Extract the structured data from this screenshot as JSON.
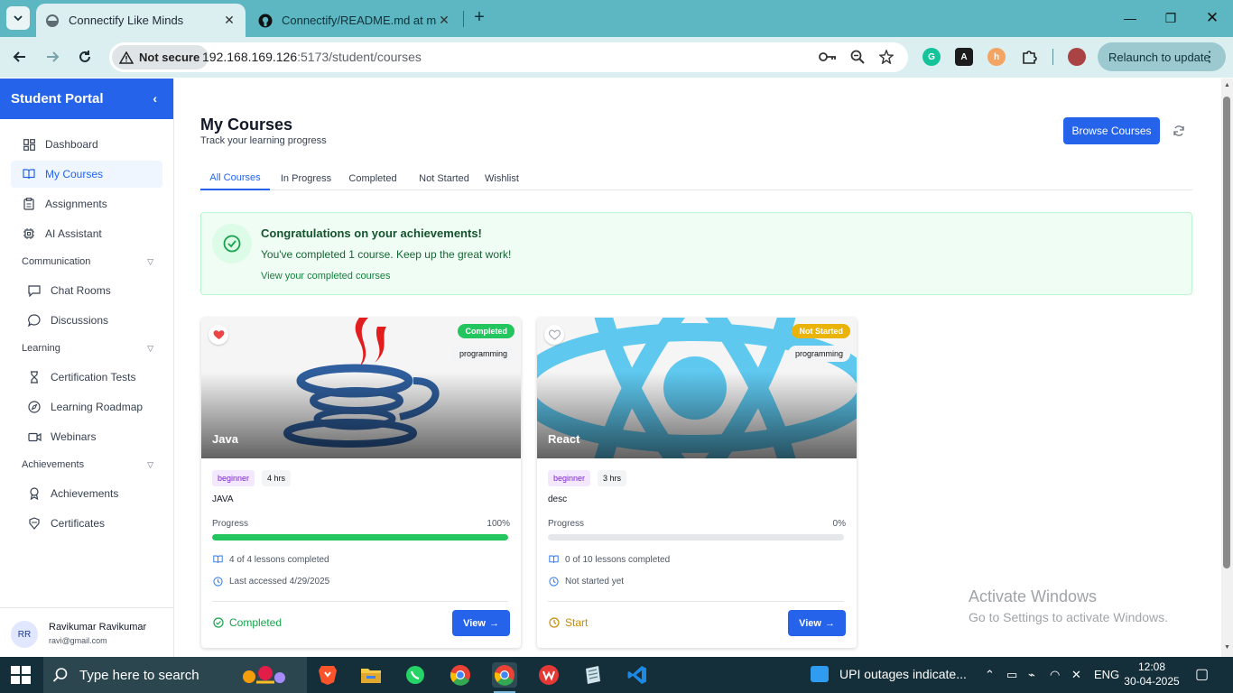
{
  "browser": {
    "tabs": [
      {
        "title": "Connectify Like Minds",
        "active": true
      },
      {
        "title": "Connectify/README.md at mai",
        "active": false
      }
    ],
    "security_label": "Not secure",
    "url_host": "192.168.169.126",
    "url_path": ":5173/student/courses",
    "relaunch_label": "Relaunch to update",
    "extensions": [
      "grammarly-icon",
      "adobe-acrobat-icon",
      "honey-icon",
      "puzzle-extensions-icon"
    ]
  },
  "sidebar": {
    "brand": "Student Portal",
    "items": [
      {
        "label": "Dashboard",
        "icon": "dashboard-grid-icon"
      },
      {
        "label": "My Courses",
        "icon": "book-open-icon",
        "active": true
      },
      {
        "label": "Assignments",
        "icon": "clipboard-icon"
      },
      {
        "label": "AI Assistant",
        "icon": "cpu-icon"
      }
    ],
    "groups": [
      {
        "label": "Communication",
        "items": [
          {
            "label": "Chat Rooms",
            "icon": "chat-square-icon"
          },
          {
            "label": "Discussions",
            "icon": "chat-bubble-icon"
          }
        ]
      },
      {
        "label": "Learning",
        "items": [
          {
            "label": "Certification Tests",
            "icon": "hourglass-icon"
          },
          {
            "label": "Learning Roadmap",
            "icon": "compass-icon"
          },
          {
            "label": "Webinars",
            "icon": "video-icon"
          }
        ]
      },
      {
        "label": "Achievements",
        "items": [
          {
            "label": "Achievements",
            "icon": "award-icon"
          },
          {
            "label": "Certificates",
            "icon": "badge-icon"
          }
        ]
      }
    ],
    "user": {
      "initials": "RR",
      "name": "Ravikumar Ravikumar",
      "email": "ravi@gmail.com"
    }
  },
  "main": {
    "title": "My Courses",
    "subtitle": "Track your learning progress",
    "browse_label": "Browse Courses",
    "tabs": [
      "All Courses",
      "In Progress",
      "Completed",
      "Not Started",
      "Wishlist"
    ],
    "active_tab": "All Courses",
    "congrats": {
      "title": "Congratulations on your achievements!",
      "text": "You've completed 1 course. Keep up the great work!",
      "link": "View your completed courses"
    },
    "courses": [
      {
        "name": "Java",
        "status": "Completed",
        "status_color": "#22c55e",
        "category": "programming",
        "level": "beginner",
        "duration": "4 hrs",
        "description": "JAVA",
        "progress_label": "Progress",
        "progress_text": "100%",
        "progress": 1.0,
        "lessons": "4 of 4 lessons completed",
        "accessed": "Last accessed 4/29/2025",
        "footer_status": "Completed",
        "footer_color": "#16a34a",
        "favorite": true,
        "view_label": "View"
      },
      {
        "name": "React",
        "status": "Not Started",
        "status_color": "#eab308",
        "category": "programming",
        "level": "beginner",
        "duration": "3 hrs",
        "description": "desc",
        "progress_label": "Progress",
        "progress_text": "0%",
        "progress": 0.0,
        "lessons": "0 of 10 lessons completed",
        "accessed": "Not started yet",
        "footer_status": "Start",
        "footer_color": "#ca8a04",
        "favorite": false,
        "view_label": "View"
      }
    ]
  },
  "watermark": {
    "line1": "Activate Windows",
    "line2": "Go to Settings to activate Windows."
  },
  "taskbar": {
    "search_placeholder": "Type here to search",
    "news": "UPI outages indicate...",
    "language": "ENG",
    "time": "12:08",
    "date": "30-04-2025"
  }
}
